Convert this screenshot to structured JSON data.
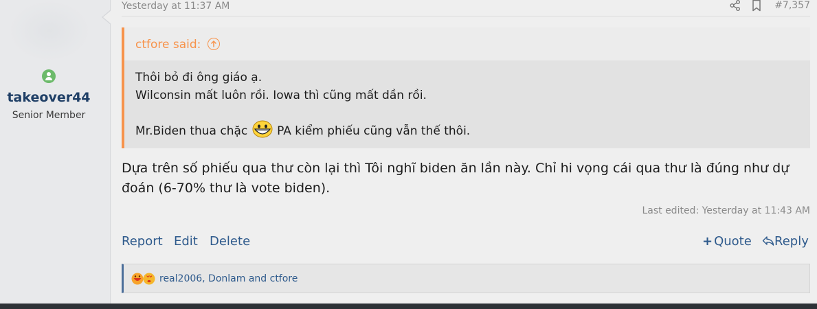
{
  "user": {
    "username": "takeover44",
    "title": "Senior Member",
    "status_icon": "user-online-icon"
  },
  "header": {
    "date": "Yesterday at 11:37 AM",
    "post_number": "#7,357",
    "share_icon": "share-icon",
    "bookmark_icon": "bookmark-icon"
  },
  "quote": {
    "author_said": "ctfore said:",
    "lines": [
      "Thôi bỏ đi ông giáo ạ.",
      "Wilconsin mất luôn rồi. Iowa thì cũng mất dần rồi.",
      "",
      "Mr.Biden thua chặc",
      "PA kiểm phiếu cũng vẫn thế thôi."
    ],
    "smiley": "grinning-smiley-icon"
  },
  "message": {
    "text": "Dựa trên số phiếu qua thư còn lại thì Tôi nghĩ biden ăn lần này. Chỉ hi vọng cái qua thư là đúng như dự đoán (6-70% thư là vote biden).",
    "last_edited": "Last edited: Yesterday at 11:43 AM"
  },
  "actions": {
    "report": "Report",
    "edit": "Edit",
    "delete": "Delete",
    "quote": "Quote",
    "reply": "Reply"
  },
  "reactions": {
    "text": "real2006, Donlam and ctfore",
    "icons": [
      "haha-reaction-icon",
      "love-reaction-icon"
    ]
  },
  "colors": {
    "quote_accent": "#f7934b",
    "link": "#2e5a8c",
    "username": "#1f3f66"
  }
}
